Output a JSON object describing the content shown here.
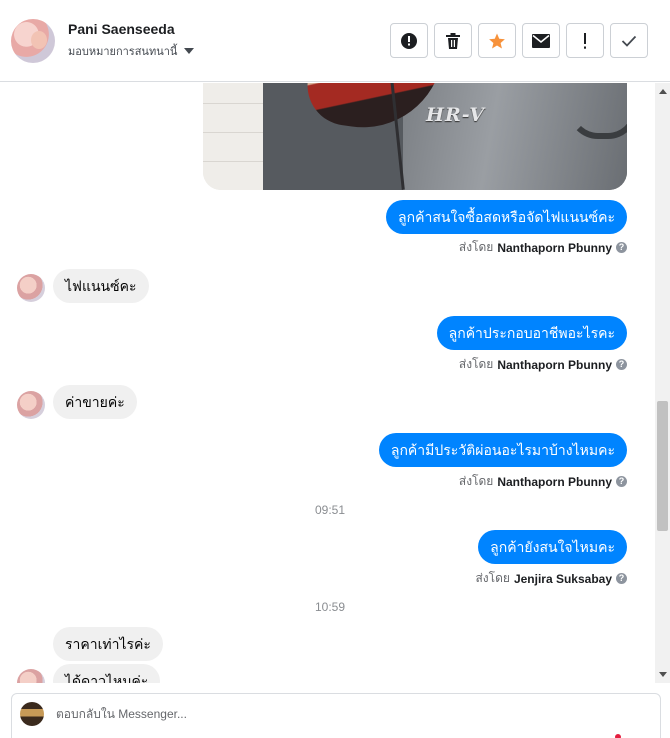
{
  "header": {
    "contact_name": "Pani Saenseeda",
    "assign_label": "มอบหมายการสนทนานี้",
    "actions": [
      {
        "name": "spam-button",
        "icon": "alert-circle-icon"
      },
      {
        "name": "delete-button",
        "icon": "trash-icon"
      },
      {
        "name": "star-button",
        "icon": "star-icon"
      },
      {
        "name": "mark-unread-button",
        "icon": "envelope-icon"
      },
      {
        "name": "important-button",
        "icon": "exclamation-icon"
      },
      {
        "name": "mark-done-button",
        "icon": "check-icon"
      }
    ]
  },
  "photo": {
    "badge_text": "HR-V"
  },
  "messages": {
    "m1": "ลูกค้าสนใจซื้อสดหรือจัดไฟแนนซ์คะ",
    "s1_prefix": "ส่งโดย",
    "s1_name": "Nanthaporn Pbunny",
    "m2": "ไฟแนนซ์คะ",
    "m3": "ลูกค้าประกอบอาชีพอะไรคะ",
    "s3_prefix": "ส่งโดย",
    "s3_name": "Nanthaporn Pbunny",
    "m4": "ค่าขายค่ะ",
    "m5": "ลูกค้ามีประวัติผ่อนอะไรมาบ้างไหมคะ",
    "s5_prefix": "ส่งโดย",
    "s5_name": "Nanthaporn Pbunny",
    "time1": "09:51",
    "m6": "ลูกค้ายังสนใจไหมคะ",
    "s6_prefix": "ส่งโดย",
    "s6_name": "Jenjira Suksabay",
    "time2": "10:59",
    "m7": "ราคาเท่าไรค่ะ",
    "m8": "ได้ดาวไหมค่ะ"
  },
  "composer": {
    "placeholder": "ตอบกลับใน Messenger..."
  },
  "colors": {
    "accent": "#0084ff",
    "incoming": "#f0f0f0",
    "star": "#f7923b"
  }
}
